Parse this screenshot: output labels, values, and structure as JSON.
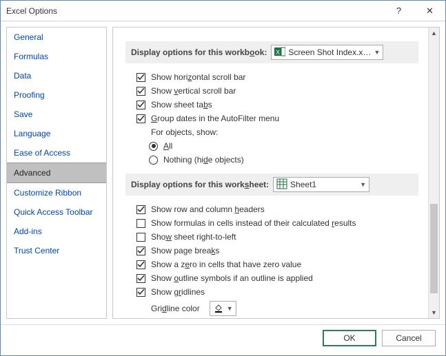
{
  "window": {
    "title": "Excel Options",
    "help_symbol": "?",
    "close_symbol": "✕"
  },
  "sidebar": {
    "items": [
      {
        "label": "General"
      },
      {
        "label": "Formulas"
      },
      {
        "label": "Data"
      },
      {
        "label": "Proofing"
      },
      {
        "label": "Save"
      },
      {
        "label": "Language"
      },
      {
        "label": "Ease of Access"
      },
      {
        "label": "Advanced"
      },
      {
        "label": "Customize Ribbon"
      },
      {
        "label": "Quick Access Toolbar"
      },
      {
        "label": "Add-ins"
      },
      {
        "label": "Trust Center"
      }
    ],
    "selected_index": 7
  },
  "workbook_section": {
    "heading_prefix": "Display options for this workb",
    "heading_uchar": "o",
    "heading_suffix": "ok:",
    "selected_workbook": "Screen Shot Index.x…",
    "options": {
      "h_scroll": {
        "checked": true,
        "pre": "Show hori",
        "u": "z",
        "post": "ontal scroll bar"
      },
      "v_scroll": {
        "checked": true,
        "pre": "Show ",
        "u": "v",
        "post": "ertical scroll bar"
      },
      "sheet_tabs": {
        "checked": true,
        "pre": "Show sheet ta",
        "u": "b",
        "post": "s"
      },
      "group_dates": {
        "checked": true,
        "pre": "",
        "u": "G",
        "post": "roup dates in the AutoFilter menu"
      },
      "objects_label": "For objects, show:",
      "radio_all": {
        "checked": true,
        "pre": "",
        "u": "A",
        "post": "ll"
      },
      "radio_nothing": {
        "checked": false,
        "pre": "Nothing (hi",
        "u": "d",
        "post": "e objects)"
      }
    }
  },
  "worksheet_section": {
    "heading_prefix": "Display options for this work",
    "heading_uchar": "s",
    "heading_suffix": "heet:",
    "selected_sheet": "Sheet1",
    "options": {
      "row_col_headers": {
        "checked": true,
        "pre": "Show row and column ",
        "u": "h",
        "post": "eaders"
      },
      "show_formulas": {
        "checked": false,
        "pre": "Show formulas in cells instead of their calculated ",
        "u": "r",
        "post": "esults"
      },
      "right_to_left": {
        "checked": false,
        "pre": "Sho",
        "u": "w",
        "post": " sheet right-to-left"
      },
      "page_breaks": {
        "checked": true,
        "pre": "Show page brea",
        "u": "k",
        "post": "s"
      },
      "zero_values": {
        "checked": true,
        "pre": "Show a z",
        "u": "e",
        "post": "ro in cells that have zero value"
      },
      "outline_symbols": {
        "checked": true,
        "pre": "Show ",
        "u": "o",
        "post": "utline symbols if an outline is applied"
      },
      "gridlines": {
        "checked": true,
        "pre": "Show g",
        "u": "r",
        "post": "idlines"
      },
      "gridline_color_label_pre": "Gri",
      "gridline_color_label_u": "d",
      "gridline_color_label_post": "line color"
    }
  },
  "footer": {
    "ok": "OK",
    "cancel": "Cancel"
  }
}
